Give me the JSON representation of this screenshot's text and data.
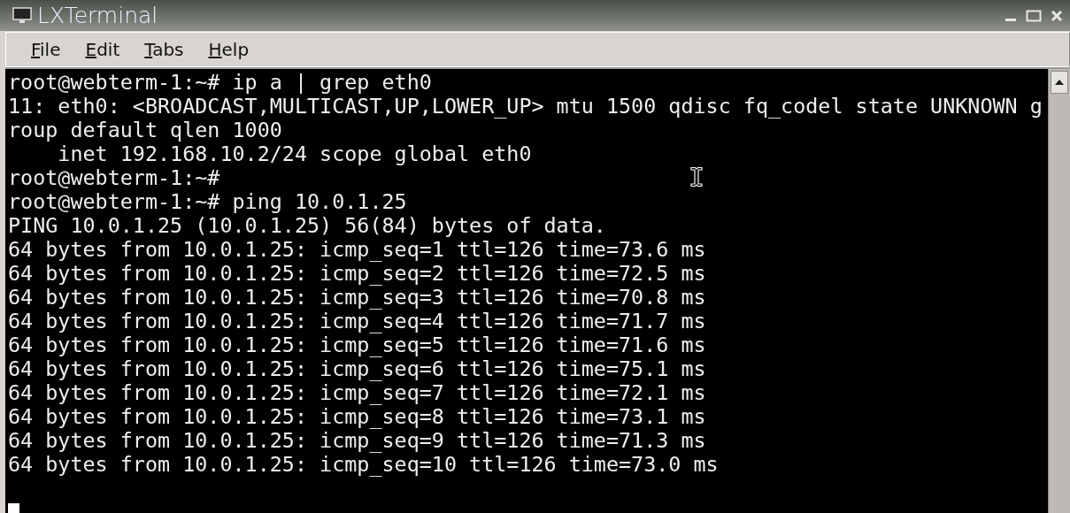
{
  "window": {
    "title": "LXTerminal"
  },
  "menu": [
    "File",
    "Edit",
    "Tabs",
    "Help"
  ],
  "terminal": {
    "lines": [
      "root@webterm-1:~# ip a | grep eth0",
      "11: eth0: <BROADCAST,MULTICAST,UP,LOWER_UP> mtu 1500 qdisc fq_codel state UNKNOWN g",
      "roup default qlen 1000",
      "    inet 192.168.10.2/24 scope global eth0",
      "root@webterm-1:~#",
      "root@webterm-1:~# ping 10.0.1.25",
      "PING 10.0.1.25 (10.0.1.25) 56(84) bytes of data.",
      "64 bytes from 10.0.1.25: icmp_seq=1 ttl=126 time=73.6 ms",
      "64 bytes from 10.0.1.25: icmp_seq=2 ttl=126 time=72.5 ms",
      "64 bytes from 10.0.1.25: icmp_seq=3 ttl=126 time=70.8 ms",
      "64 bytes from 10.0.1.25: icmp_seq=4 ttl=126 time=71.7 ms",
      "64 bytes from 10.0.1.25: icmp_seq=5 ttl=126 time=71.6 ms",
      "64 bytes from 10.0.1.25: icmp_seq=6 ttl=126 time=75.1 ms",
      "64 bytes from 10.0.1.25: icmp_seq=7 ttl=126 time=72.1 ms",
      "64 bytes from 10.0.1.25: icmp_seq=8 ttl=126 time=73.1 ms",
      "64 bytes from 10.0.1.25: icmp_seq=9 ttl=126 time=71.3 ms",
      "64 bytes from 10.0.1.25: icmp_seq=10 ttl=126 time=73.0 ms"
    ]
  }
}
